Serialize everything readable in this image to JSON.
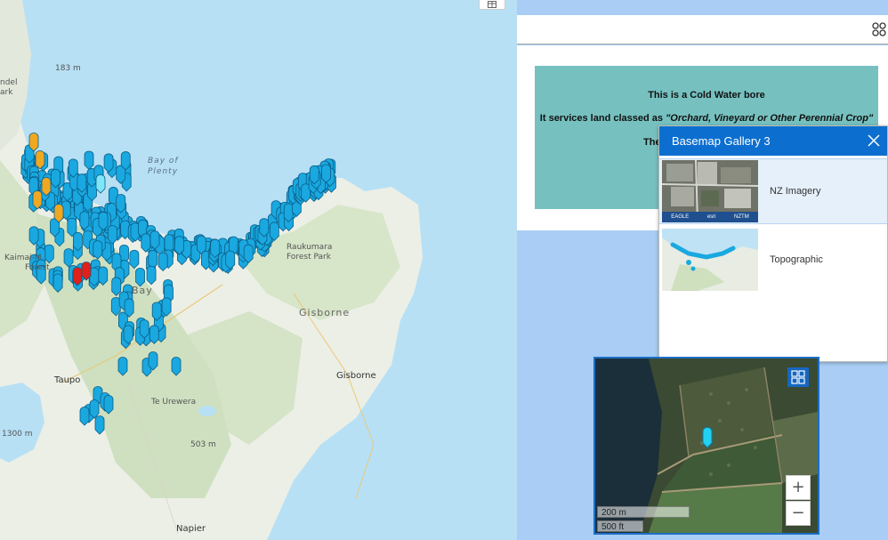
{
  "map": {
    "labels": {
      "elev_183": "183 m",
      "bay_line1": "Bay of",
      "bay_line2": "Plenty",
      "raukumara_line1": "Raukumara",
      "raukumara_line2": "Forest Park",
      "kaimai_line1": "Kaimai-M",
      "kaimai_line2": "Forest",
      "bay_small": "Bay",
      "gisborne_region": "Gisborne",
      "gisborne_city": "Gisborne",
      "taupo": "Taupo",
      "te_urewera": "Te Urewera",
      "elev_503": "503 m",
      "elev_1300": "1300 m",
      "napier": "Napier",
      "ndel": "ndel",
      "ark": "ark"
    },
    "corner_button_icon": "table-icon",
    "colors": {
      "water": "#b7e0f5",
      "land": "#ecefe6",
      "forest": "#c9ddb8",
      "marker_blue": "#1aa8e0",
      "marker_orange": "#f0a822",
      "marker_red": "#e0201a"
    }
  },
  "popup": {
    "line1": "This is a Cold Water bore",
    "line2_prefix": "It services land classed as ",
    "line2_class": "\"Orchard, Vineyard or Other Perennial Crop\"",
    "line3": "The",
    "background": "#76c1c0"
  },
  "top_strip": {
    "launcher_icon": "app-launcher-icon"
  },
  "basemap_gallery": {
    "title": "Basemap Gallery 3",
    "close_icon": "close-icon",
    "items": [
      {
        "label": "NZ Imagery",
        "selected": true,
        "thumb_credits": [
          "EAGLE",
          "esri",
          "NZTM"
        ]
      },
      {
        "label": "Topographic",
        "selected": false
      }
    ],
    "header_color": "#0c6fcf"
  },
  "overview": {
    "gallery_icon": "basemap-gallery-icon",
    "zoom_in": "+",
    "zoom_out": "−",
    "scale_metric": "200 m",
    "scale_imperial": "500 ft"
  }
}
